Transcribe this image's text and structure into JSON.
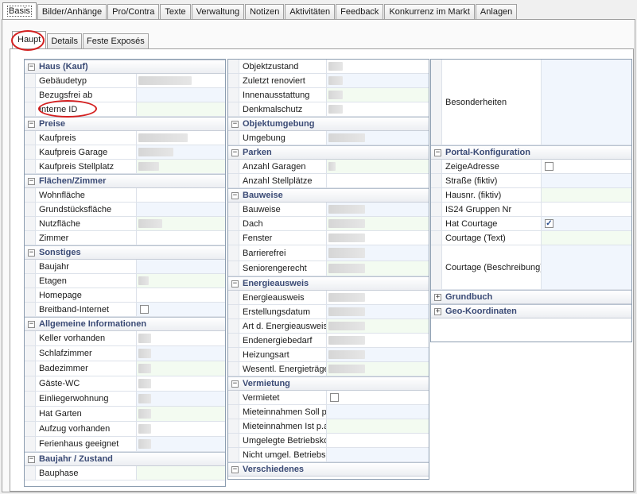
{
  "main_tabs": [
    "Basis",
    "Bilder/Anhänge",
    "Pro/Contra",
    "Texte",
    "Verwaltung",
    "Notizen",
    "Aktivitäten",
    "Feedback",
    "Konkurrenz im Markt",
    "Anlagen"
  ],
  "sub_tabs": [
    "Haupt",
    "Details",
    "Feste Exposés"
  ],
  "col1": {
    "haus": {
      "title": "Haus (Kauf)",
      "rows": [
        "Gebäudetyp",
        "Bezugsfrei ab",
        "Interne ID"
      ]
    },
    "preise": {
      "title": "Preise",
      "rows": [
        "Kaufpreis",
        "Kaufpreis Garage",
        "Kaufpreis Stellplatz"
      ]
    },
    "flaechen": {
      "title": "Flächen/Zimmer",
      "rows": [
        "Wohnfläche",
        "Grundstücksfläche",
        "Nutzfläche",
        "Zimmer"
      ]
    },
    "sonstiges": {
      "title": "Sonstiges",
      "rows": [
        "Baujahr",
        "Etagen",
        "Homepage",
        "Breitband-Internet"
      ]
    },
    "allgemein": {
      "title": "Allgemeine Informationen",
      "rows": [
        "Keller vorhanden",
        "Schlafzimmer",
        "Badezimmer",
        "Gäste-WC",
        "Einliegerwohnung",
        "Hat Garten",
        "Aufzug vorhanden",
        "Ferienhaus geeignet"
      ]
    },
    "baujahr": {
      "title": "Baujahr / Zustand",
      "rows": [
        "Bauphase"
      ]
    }
  },
  "col2": {
    "zustand": {
      "rows": [
        "Objektzustand",
        "Zuletzt renoviert",
        "Innenausstattung",
        "Denkmalschutz"
      ]
    },
    "umgebung": {
      "title": "Objektumgebung",
      "rows": [
        "Umgebung"
      ]
    },
    "parken": {
      "title": "Parken",
      "rows": [
        "Anzahl Garagen",
        "Anzahl Stellplätze"
      ]
    },
    "bauweise": {
      "title": "Bauweise",
      "rows": [
        "Bauweise",
        "Dach",
        "Fenster",
        "Barrierefrei",
        "Seniorengerecht"
      ]
    },
    "energie": {
      "title": "Energieausweis",
      "rows": [
        "Energieausweis",
        "Erstellungsdatum",
        "Art d. Energieausweis",
        "Endenergiebedarf",
        "Heizungsart",
        "Wesentl. Energieträger"
      ]
    },
    "vermietung": {
      "title": "Vermietung",
      "rows": [
        "Vermietet",
        "Mieteinnahmen Soll p.a.",
        "Mieteinnahmen Ist p.a.",
        "Umgelegte Betriebskosten",
        "Nicht umgel. Betriebskosten"
      ]
    },
    "verschiedenes": {
      "title": "Verschiedenes"
    }
  },
  "col3": {
    "besonderheiten": "Besonderheiten",
    "portal": {
      "title": "Portal-Konfiguration",
      "rows": [
        "ZeigeAdresse",
        "Straße (fiktiv)",
        "Hausnr. (fiktiv)",
        "IS24 Gruppen Nr",
        "Hat Courtage",
        "Courtage (Text)",
        "Courtage (Beschreibung)"
      ]
    },
    "grundbuch": {
      "title": "Grundbuch"
    },
    "geo": {
      "title": "Geo-Koordinaten"
    }
  },
  "checkboxes": {
    "breitband": false,
    "vermietet": false,
    "zeige_adresse": false,
    "hat_courtage": true
  },
  "toggles": {
    "expanded": "−",
    "collapsed": "+"
  },
  "check_mark": "✓"
}
